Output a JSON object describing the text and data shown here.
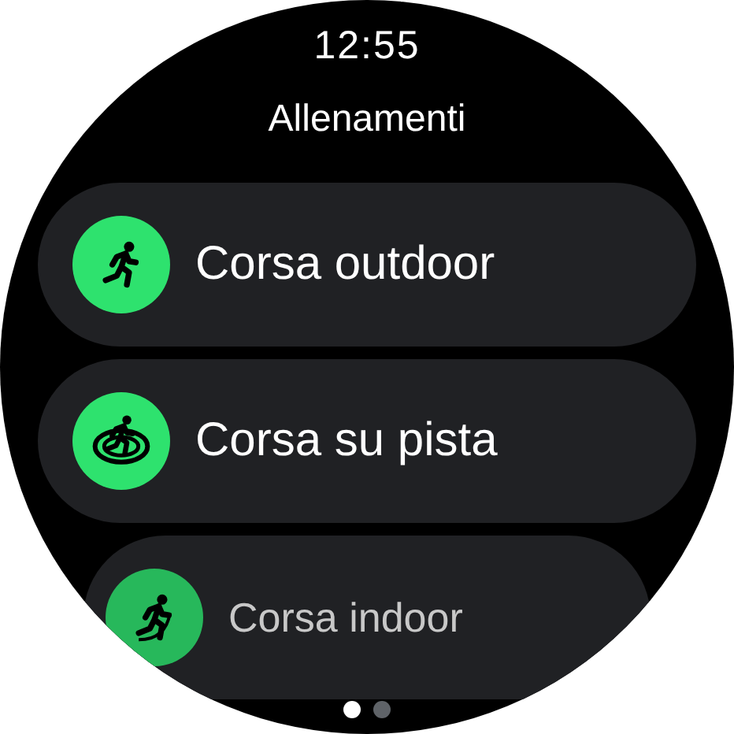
{
  "status_bar": {
    "time": "12:55"
  },
  "title": "Allenamenti",
  "workouts": [
    {
      "label": "Corsa outdoor",
      "kind": "outdoor"
    },
    {
      "label": "Corsa su pista",
      "kind": "track"
    },
    {
      "label": "Corsa indoor",
      "kind": "indoor"
    }
  ],
  "pages": [
    {
      "selected": true
    },
    {
      "selected": false
    }
  ]
}
